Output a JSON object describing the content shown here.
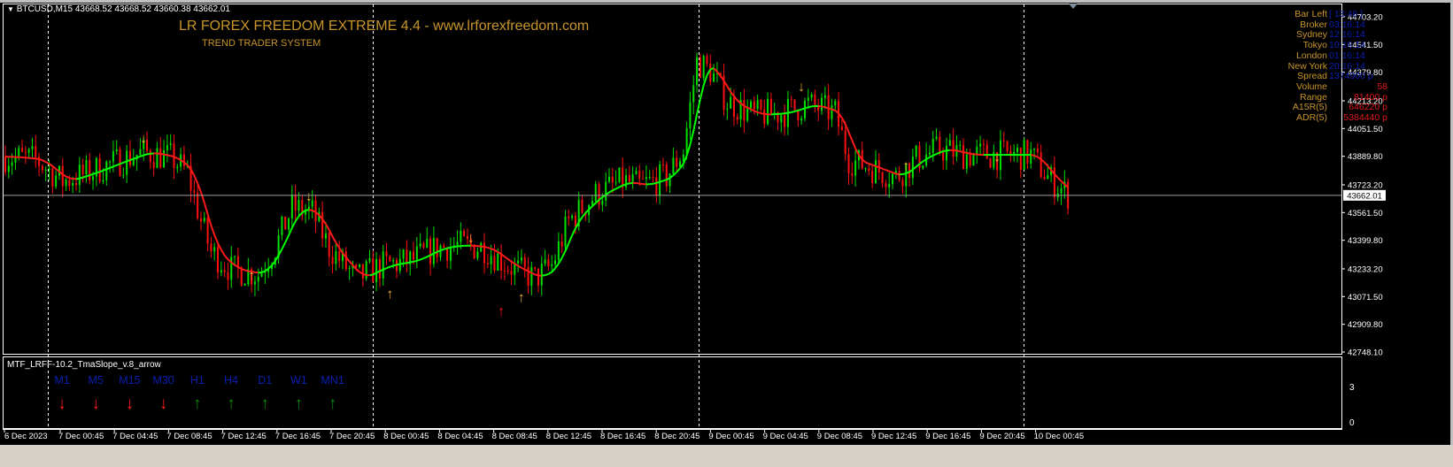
{
  "header": {
    "symbol_line": "BTCUSD,M15  43668.52 43668.52 43660.38 43662.01"
  },
  "indicator_title": "LR FOREX FREEDOM EXTREME 4.4 - www.lrforexfreedom.com",
  "indicator_subtitle": "TREND TRADER SYSTEM",
  "info_panel": [
    {
      "label": "Bar Left",
      "value": "[ 13:46 ]",
      "color": "#0b1fb0"
    },
    {
      "label": "Broker",
      "value": "03:16:14",
      "color": "#0b1fb0"
    },
    {
      "label": "Sydney",
      "value": "12:16:14",
      "color": "#0b1fb0"
    },
    {
      "label": "Tokyo",
      "value": "10:16:14",
      "color": "#0b1fb0"
    },
    {
      "label": "London",
      "value": "01:16:14",
      "color": "#0b1fb0"
    },
    {
      "label": "New York",
      "value": "20:16:14",
      "color": "#0b1fb0"
    },
    {
      "label": "Spread",
      "value": "1374900 p",
      "color": "#0b1fb0"
    },
    {
      "label": "Volume",
      "value": "58",
      "color": "#e01b1b"
    },
    {
      "label": "Range",
      "value": "81400 p",
      "color": "#e01b1b"
    },
    {
      "label": "A15R(5)",
      "value": "646220 p",
      "color": "#e01b1b"
    },
    {
      "label": "ADR(5)",
      "value": "5384440 p",
      "color": "#e01b1b"
    }
  ],
  "subwindow": {
    "name": "MTF_LRFF-10.2_TmaSlope_v.8_arrow",
    "scale_top": "3",
    "scale_bottom": "0",
    "timeframes": [
      {
        "label": "M1",
        "dir": "down"
      },
      {
        "label": "M5",
        "dir": "down"
      },
      {
        "label": "M15",
        "dir": "down"
      },
      {
        "label": "M30",
        "dir": "down"
      },
      {
        "label": "H1",
        "dir": "up"
      },
      {
        "label": "H4",
        "dir": "up"
      },
      {
        "label": "D1",
        "dir": "up"
      },
      {
        "label": "W1",
        "dir": "up"
      },
      {
        "label": "MN1",
        "dir": "up"
      }
    ]
  },
  "colors": {
    "bull": "#00e000",
    "bear": "#ff1010",
    "ma_up": "#00ff00",
    "ma_down": "#ff1a1a",
    "arrow_gold": "#e6a532",
    "arrow_red": "#ff1010",
    "tf_label": "#0b1fb0",
    "tf_up": "#0a8a0a",
    "tf_down": "#ff1a1a"
  },
  "chart_data": {
    "type": "candlestick",
    "symbol": "BTCUSD",
    "timeframe": "M15",
    "current_price": "43662.01",
    "ylim": [
      42748.1,
      44703.2
    ],
    "y_ticks": [
      "44703.20",
      "44541.50",
      "44379.80",
      "44213.20",
      "44051.50",
      "43889.80",
      "43723.20",
      "43561.50",
      "43399.80",
      "43233.20",
      "43071.50",
      "42909.80",
      "42748.10"
    ],
    "x_ticks": [
      "6 Dec 2023",
      "7 Dec 00:45",
      "7 Dec 04:45",
      "7 Dec 08:45",
      "7 Dec 12:45",
      "7 Dec 16:45",
      "7 Dec 20:45",
      "8 Dec 00:45",
      "8 Dec 04:45",
      "8 Dec 08:45",
      "8 Dec 12:45",
      "8 Dec 16:45",
      "8 Dec 20:45",
      "9 Dec 00:45",
      "9 Dec 04:45",
      "9 Dec 08:45",
      "9 Dec 12:45",
      "9 Dec 16:45",
      "9 Dec 20:45",
      "10 Dec 00:45"
    ],
    "bars_total": 316,
    "price_path": [
      [
        0,
        43888
      ],
      [
        9,
        43872
      ],
      [
        17,
        43744
      ],
      [
        25,
        43795
      ],
      [
        33,
        43857
      ],
      [
        41,
        43914
      ],
      [
        49,
        43883
      ],
      [
        54,
        43795
      ],
      [
        58,
        43511
      ],
      [
        61,
        43331
      ],
      [
        67,
        43228
      ],
      [
        75,
        43202
      ],
      [
        80,
        43356
      ],
      [
        85,
        43589
      ],
      [
        91,
        43563
      ],
      [
        96,
        43356
      ],
      [
        104,
        43176
      ],
      [
        112,
        43253
      ],
      [
        120,
        43279
      ],
      [
        128,
        43356
      ],
      [
        135,
        43372
      ],
      [
        142,
        43356
      ],
      [
        149,
        43253
      ],
      [
        157,
        43176
      ],
      [
        162,
        43253
      ],
      [
        167,
        43511
      ],
      [
        175,
        43666
      ],
      [
        183,
        43744
      ],
      [
        188,
        43718
      ],
      [
        196,
        43769
      ],
      [
        201,
        43924
      ],
      [
        205,
        44440
      ],
      [
        209,
        44388
      ],
      [
        214,
        44208
      ],
      [
        222,
        44130
      ],
      [
        230,
        44141
      ],
      [
        238,
        44192
      ],
      [
        246,
        44141
      ],
      [
        250,
        43872
      ],
      [
        257,
        43821
      ],
      [
        264,
        43769
      ],
      [
        270,
        43872
      ],
      [
        277,
        43934
      ],
      [
        285,
        43898
      ],
      [
        293,
        43898
      ],
      [
        304,
        43898
      ],
      [
        309,
        43769
      ],
      [
        315,
        43666
      ]
    ],
    "signal_arrows": [
      {
        "bar": 41,
        "price": 44000,
        "dir": "down",
        "color": "gold"
      },
      {
        "bar": 73,
        "price": 43200,
        "dir": "up",
        "color": "gold"
      },
      {
        "bar": 90,
        "price": 43660,
        "dir": "down",
        "color": "gold"
      },
      {
        "bar": 114,
        "price": 43090,
        "dir": "up",
        "color": "gold"
      },
      {
        "bar": 138,
        "price": 43420,
        "dir": "down",
        "color": "gold"
      },
      {
        "bar": 147,
        "price": 42990,
        "dir": "up",
        "color": "red"
      },
      {
        "bar": 153,
        "price": 43070,
        "dir": "up",
        "color": "gold"
      },
      {
        "bar": 236,
        "price": 44300,
        "dir": "down",
        "color": "gold"
      },
      {
        "bar": 247,
        "price": 44140,
        "dir": "down",
        "color": "red"
      },
      {
        "bar": 267,
        "price": 43840,
        "dir": "up",
        "color": "gold"
      },
      {
        "bar": 294,
        "price": 43890,
        "dir": "down",
        "color": "gold"
      }
    ]
  }
}
